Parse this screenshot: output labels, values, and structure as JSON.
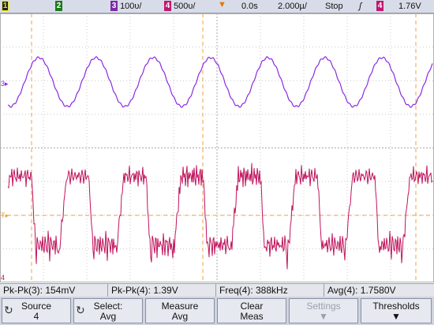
{
  "status_bar": {
    "ch1": "1",
    "ch2": "2",
    "ch3": "3",
    "ch3_scale": "100υ/",
    "ch4": "4",
    "ch4_scale": "500υ/",
    "trigger_marker": "▼",
    "delay": "0.0s",
    "timebase": "2.000µ/",
    "run_state": "Stop",
    "trigger_slope": "ʃ",
    "trig_channel": "4",
    "trig_level": "1.76V"
  },
  "waveforms": {
    "ch3_label": "3",
    "trig_label": "T",
    "ch4_label": "4",
    "colors": {
      "ch3": "#8a2be2",
      "ch4": "#c0135c",
      "cursor": "#f0a040",
      "grid": "#c8c8c8"
    }
  },
  "measurements": {
    "m1": "Pk-Pk(3): 154mV",
    "m2": "Pk-Pk(4): 1.39V",
    "m3": "Freq(4): 388kHz",
    "m4": "Avg(4): 1.7580V"
  },
  "softkeys": {
    "k1_a": "Source",
    "k1_b": "4",
    "k2_a": "Select:",
    "k2_b": "Avg",
    "k3_a": "Measure",
    "k3_b": "Avg",
    "k4_a": "Clear",
    "k4_b": "Meas",
    "k5_a": "Settings",
    "k6_a": "Thresholds"
  }
}
